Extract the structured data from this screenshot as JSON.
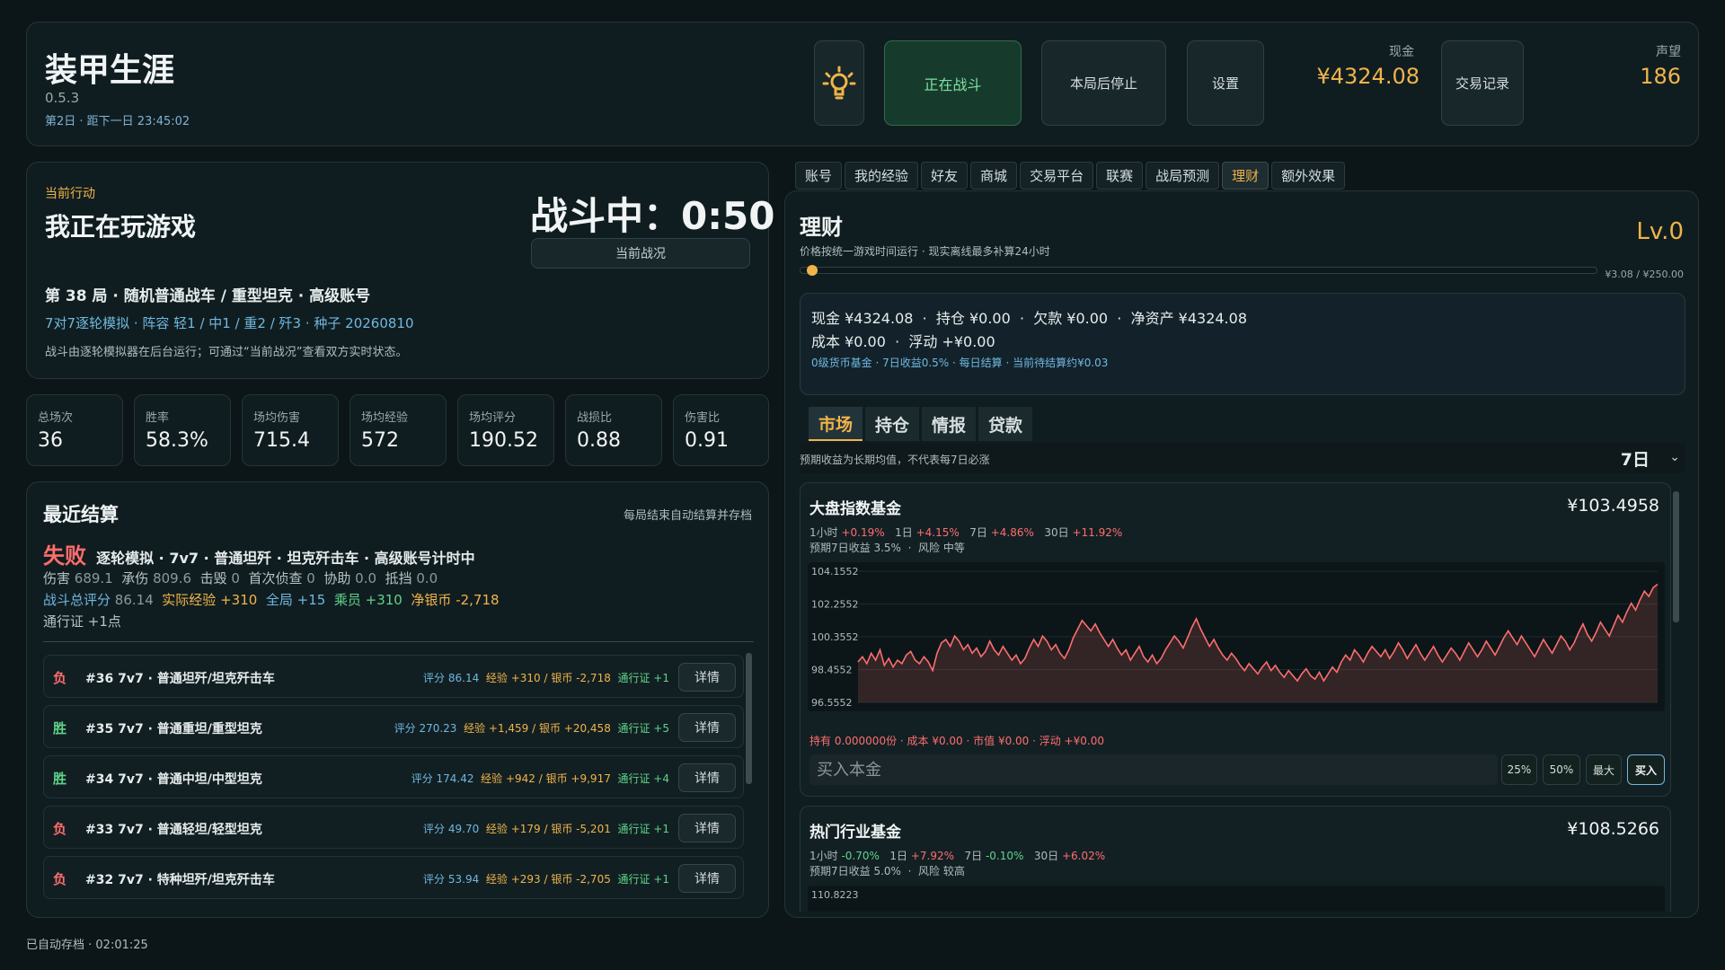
{
  "header": {
    "title": "装甲生涯",
    "version": "0.5.3",
    "day_info": "第2日 · 距下一日 23:45:02",
    "idea_icon": "lightbulb-icon",
    "battle_btn": "正在战斗",
    "stop_btn": "本局后停止",
    "settings_btn": "设置",
    "cash_label": "现金",
    "cash_value": "¥4324.08",
    "trade_log_btn": "交易记录",
    "reputation_label": "声望",
    "reputation_value": "186"
  },
  "action": {
    "tag": "当前行动",
    "title": "我正在玩游戏",
    "timer": "战斗中：0:50",
    "status_btn": "当前战况",
    "match_line": "第 38 局 · 随机普通战车 / 重型坦克 · 高级账号",
    "mode_line": "7对7逐轮模拟 · 阵容 轻1 / 中1 / 重2 / 歼3 · 种子 20260810",
    "desc_line": "战斗由逐轮模拟器在后台运行；可通过“当前战况”查看双方实时状态。"
  },
  "stats": [
    {
      "label": "总场次",
      "value": "36"
    },
    {
      "label": "胜率",
      "value": "58.3%"
    },
    {
      "label": "场均伤害",
      "value": "715.4"
    },
    {
      "label": "场均经验",
      "value": "572"
    },
    {
      "label": "场均评分",
      "value": "190.52"
    },
    {
      "label": "战损比",
      "value": "0.88"
    },
    {
      "label": "伤害比",
      "value": "0.91"
    }
  ],
  "recent": {
    "title": "最近结算",
    "note": "每局结束自动结算并存档",
    "result": "失败",
    "result_desc": "逐轮模拟 · 7v7 · 普通坦歼 · 坦克歼击车 · 高级账号计时中",
    "line_a": {
      "dmg_label": "伤害",
      "dmg": "689.1",
      "tank_label": "承伤",
      "tank": "809.6",
      "kill_label": "击毁",
      "kill": "0",
      "spot_label": "首次侦查",
      "spot": "0",
      "assist_label": "协助",
      "assist": "0.0",
      "block_label": "抵挡",
      "block": "0.0"
    },
    "line_b": {
      "score_label": "战斗总评分",
      "score": "86.14",
      "exp_label": "实际经验",
      "exp": "+310",
      "global_label": "全局",
      "global": "+15",
      "crew_label": "乘员",
      "crew": "+310",
      "silver_label": "净银币",
      "silver": "-2,718"
    },
    "line_c": {
      "pass_label": "通行证",
      "pass": "+1点"
    },
    "rows": [
      {
        "wl": "负",
        "name": "#36  7v7 · 普通坦歼/坦克歼击车",
        "score_label": "评分",
        "score": "86.14",
        "econ": "经验 +310 / 银币 -2,718",
        "pass": "通行证 +1",
        "detail": "详情"
      },
      {
        "wl": "胜",
        "name": "#35  7v7 · 普通重坦/重型坦克",
        "score_label": "评分",
        "score": "270.23",
        "econ": "经验 +1,459 / 银币 +20,458",
        "pass": "通行证 +5",
        "detail": "详情"
      },
      {
        "wl": "胜",
        "name": "#34  7v7 · 普通中坦/中型坦克",
        "score_label": "评分",
        "score": "174.42",
        "econ": "经验 +942 / 银币 +9,917",
        "pass": "通行证 +4",
        "detail": "详情"
      },
      {
        "wl": "负",
        "name": "#33  7v7 · 普通轻坦/轻型坦克",
        "score_label": "评分",
        "score": "49.70",
        "econ": "经验 +179 / 银币 -5,201",
        "pass": "通行证 +1",
        "detail": "详情"
      },
      {
        "wl": "负",
        "name": "#32  7v7 · 特种坦歼/坦克歼击车",
        "score_label": "评分",
        "score": "53.94",
        "econ": "经验 +293 / 银币 -2,705",
        "pass": "通行证 +1",
        "detail": "详情"
      }
    ]
  },
  "tabs": [
    "账号",
    "我的经验",
    "好友",
    "商城",
    "交易平台",
    "联赛",
    "战局预测",
    "理财",
    "额外效果"
  ],
  "active_tab": "理财",
  "finance": {
    "title": "理财",
    "subtitle": "价格按统一游戏时间运行 · 现实离线最多补算24小时",
    "level": "Lv.0",
    "progress_label": "¥3.08 / ¥250.00",
    "progress_fraction": 0.0123,
    "summary": {
      "cash": "现金 ¥4324.08",
      "holding": "持仓 ¥0.00",
      "debt": "欠款 ¥0.00",
      "net": "净资产 ¥4324.08",
      "cost": "成本 ¥0.00",
      "float": "浮动 +¥0.00",
      "note": "0级货币基金 · 7日收益0.5% · 每日结算 · 当前待结算约¥0.03"
    },
    "subtabs": [
      "市场",
      "持仓",
      "情报",
      "贷款"
    ],
    "filter_note": "预期收益为长期均值，不代表每7日必涨",
    "period": "7日",
    "funds": [
      {
        "name": "大盘指数基金",
        "price": "¥103.4958",
        "perf": [
          {
            "label": "1小时",
            "value": "+0.19%"
          },
          {
            "label": "1日",
            "value": "+4.15%"
          },
          {
            "label": "7日",
            "value": "+4.86%"
          },
          {
            "label": "30日",
            "value": "+11.92%"
          }
        ],
        "expected": "预期7日收益 3.5%",
        "risk": "风险 中等",
        "holding": "持有 0.000000份 · 成本 ¥0.00 · 市值 ¥0.00 · 浮动 +¥0.00",
        "buy_placeholder": "买入本金",
        "quick": [
          "25%",
          "50%",
          "最大"
        ],
        "buy": "买入"
      },
      {
        "name": "热门行业基金",
        "price": "¥108.5266",
        "perf": [
          {
            "label": "1小时",
            "value": "-0.70%"
          },
          {
            "label": "1日",
            "value": "+7.92%"
          },
          {
            "label": "7日",
            "value": "-0.10%"
          },
          {
            "label": "30日",
            "value": "+6.02%"
          }
        ],
        "expected": "预期7日收益 5.0%",
        "risk": "风险 较高",
        "first_tick": "110.8223"
      }
    ]
  },
  "chart_data": {
    "type": "area",
    "title": "",
    "ylim": [
      96.5552,
      104.1552
    ],
    "yticks": [
      "104.1552",
      "102.2552",
      "100.3552",
      "98.4552",
      "96.5552"
    ],
    "color": "#ff6d6d",
    "values": [
      98.9,
      99.2,
      98.8,
      99.4,
      99.0,
      99.6,
      98.7,
      99.1,
      98.6,
      99.0,
      98.8,
      99.3,
      99.5,
      99.0,
      98.8,
      99.2,
      98.9,
      98.4,
      99.4,
      100.0,
      100.2,
      99.8,
      100.4,
      100.1,
      99.6,
      99.9,
      99.4,
      99.7,
      99.2,
      99.5,
      100.1,
      99.6,
      99.3,
      99.8,
      99.4,
      99.0,
      99.3,
      98.8,
      99.1,
      99.7,
      100.2,
      99.8,
      100.4,
      100.1,
      99.6,
      99.9,
      99.4,
      99.1,
      99.6,
      100.3,
      100.8,
      101.3,
      101.0,
      100.7,
      101.1,
      100.6,
      100.2,
      99.8,
      100.2,
      99.7,
      99.3,
      99.6,
      99.0,
      99.4,
      99.8,
      99.2,
      98.9,
      99.3,
      98.8,
      99.1,
      99.6,
      100.0,
      100.4,
      100.1,
      99.7,
      100.3,
      100.9,
      101.4,
      100.8,
      100.3,
      99.8,
      100.2,
      99.7,
      99.3,
      99.0,
      99.4,
      99.1,
      98.7,
      98.4,
      98.8,
      98.5,
      98.2,
      98.6,
      98.9,
      98.4,
      98.7,
      98.3,
      98.0,
      98.4,
      98.1,
      97.8,
      98.2,
      98.5,
      98.1,
      97.9,
      98.3,
      97.8,
      98.2,
      98.6,
      98.3,
      98.9,
      99.3,
      99.0,
      99.6,
      99.3,
      98.9,
      99.4,
      99.8,
      99.5,
      99.2,
      99.6,
      99.1,
      99.5,
      100.0,
      99.6,
      99.1,
      99.5,
      99.9,
      99.4,
      99.0,
      99.4,
      99.8,
      99.3,
      98.9,
      99.3,
      99.7,
      99.4,
      99.0,
      99.5,
      100.0,
      99.6,
      99.2,
      99.6,
      100.1,
      99.7,
      99.3,
      99.8,
      100.3,
      100.7,
      100.3,
      99.9,
      100.4,
      100.0,
      99.6,
      99.2,
      99.7,
      100.2,
      99.8,
      99.4,
      99.9,
      100.4,
      100.1,
      99.6,
      100.0,
      100.6,
      101.1,
      100.5,
      100.1,
      100.6,
      101.2,
      100.8,
      100.4,
      101.0,
      101.6,
      101.2,
      101.8,
      102.3,
      101.9,
      102.5,
      103.0,
      102.7,
      103.2,
      103.4
    ]
  }
}
